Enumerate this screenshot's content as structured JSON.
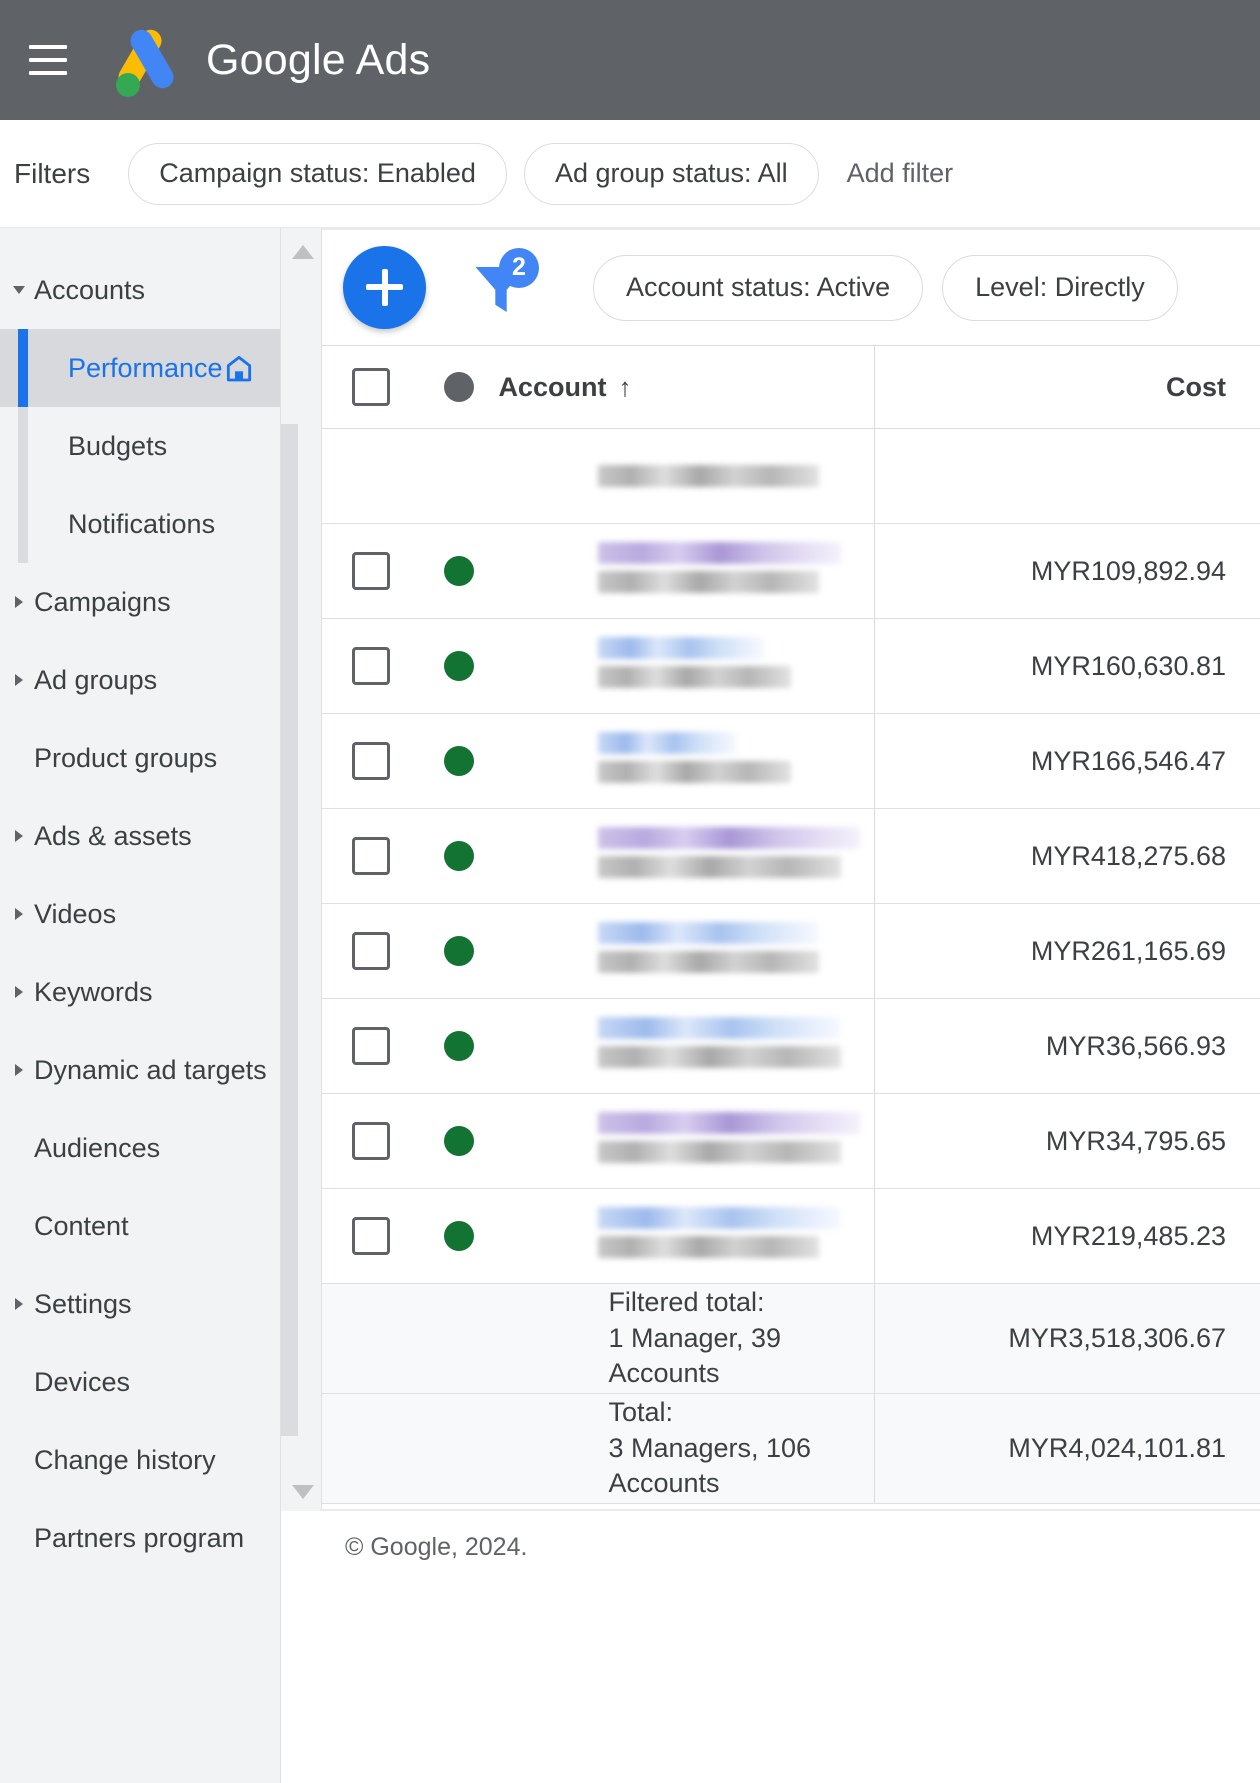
{
  "appbar": {
    "menu_icon": "hamburger-menu-icon",
    "logo_icon": "google-ads-logo",
    "title": "Google Ads"
  },
  "filterbar": {
    "label": "Filters",
    "chips": [
      "Campaign status: Enabled",
      "Ad group status: All"
    ],
    "add_filter": "Add filter"
  },
  "sidebar": {
    "items": [
      {
        "label": "Accounts",
        "level": 1,
        "caret": "down",
        "selected": false
      },
      {
        "label": "Performance",
        "level": 2,
        "caret": "none",
        "selected": true,
        "icon": "home-icon"
      },
      {
        "label": "Budgets",
        "level": 2,
        "caret": "none",
        "selected": false
      },
      {
        "label": "Notifications",
        "level": 2,
        "caret": "none",
        "selected": false
      },
      {
        "label": "Campaigns",
        "level": 1,
        "caret": "right",
        "selected": false
      },
      {
        "label": "Ad groups",
        "level": 1,
        "caret": "right",
        "selected": false
      },
      {
        "label": "Product groups",
        "level": 1,
        "caret": "none",
        "selected": false
      },
      {
        "label": "Ads & assets",
        "level": 1,
        "caret": "right",
        "selected": false
      },
      {
        "label": "Videos",
        "level": 1,
        "caret": "right",
        "selected": false
      },
      {
        "label": "Keywords",
        "level": 1,
        "caret": "right",
        "selected": false
      },
      {
        "label": "Dynamic ad targets",
        "level": 1,
        "caret": "right",
        "selected": false
      },
      {
        "label": "Audiences",
        "level": 1,
        "caret": "none",
        "selected": false
      },
      {
        "label": "Content",
        "level": 1,
        "caret": "none",
        "selected": false
      },
      {
        "label": "Settings",
        "level": 1,
        "caret": "right",
        "selected": false
      },
      {
        "label": "Devices",
        "level": 1,
        "caret": "none",
        "selected": false
      },
      {
        "label": "Change history",
        "level": 1,
        "caret": "none",
        "selected": false
      },
      {
        "label": "Partners program",
        "level": 1,
        "caret": "none",
        "selected": false
      }
    ]
  },
  "toolbar": {
    "add_button": "+",
    "filter_icon": "filter-funnel-icon",
    "filter_badge": "2",
    "chips": [
      "Account status: Active",
      "Level: Directly"
    ]
  },
  "table": {
    "columns": {
      "checkbox": "select-all",
      "status": "status-dot",
      "account": "Account",
      "sort_indicator": "↑",
      "cost": "Cost"
    },
    "rows": [
      {
        "status": "green",
        "account_redacted": true,
        "cost": ""
      },
      {
        "status": "green",
        "account_redacted": true,
        "cost": "MYR109,892.94"
      },
      {
        "status": "green",
        "account_redacted": true,
        "cost": "MYR160,630.81"
      },
      {
        "status": "green",
        "account_redacted": true,
        "cost": "MYR166,546.47"
      },
      {
        "status": "green",
        "account_redacted": true,
        "cost": "MYR418,275.68"
      },
      {
        "status": "green",
        "account_redacted": true,
        "cost": "MYR261,165.69"
      },
      {
        "status": "green",
        "account_redacted": true,
        "cost": "MYR36,566.93"
      },
      {
        "status": "green",
        "account_redacted": true,
        "cost": "MYR34,795.65"
      },
      {
        "status": "green",
        "account_redacted": true,
        "cost": "MYR219,485.23"
      }
    ],
    "totals": [
      {
        "title": "Filtered total:",
        "subtitle": "1 Manager, 39 Accounts",
        "cost": "MYR3,518,306.67"
      },
      {
        "title": "Total:",
        "subtitle": "3 Managers, 106 Accounts",
        "cost": "MYR4,024,101.81"
      }
    ]
  },
  "footer": {
    "copyright": "© Google, 2024."
  },
  "colors": {
    "appbar_bg": "#5f6368",
    "accent_blue": "#1a73e8",
    "badge_blue": "#4285f4",
    "status_green": "#137333",
    "status_gray": "#5f6368",
    "sidebar_bg": "#f1f3f4",
    "logo_yellow": "#fbbc04",
    "logo_blue": "#4285f4",
    "logo_green": "#34a853"
  }
}
